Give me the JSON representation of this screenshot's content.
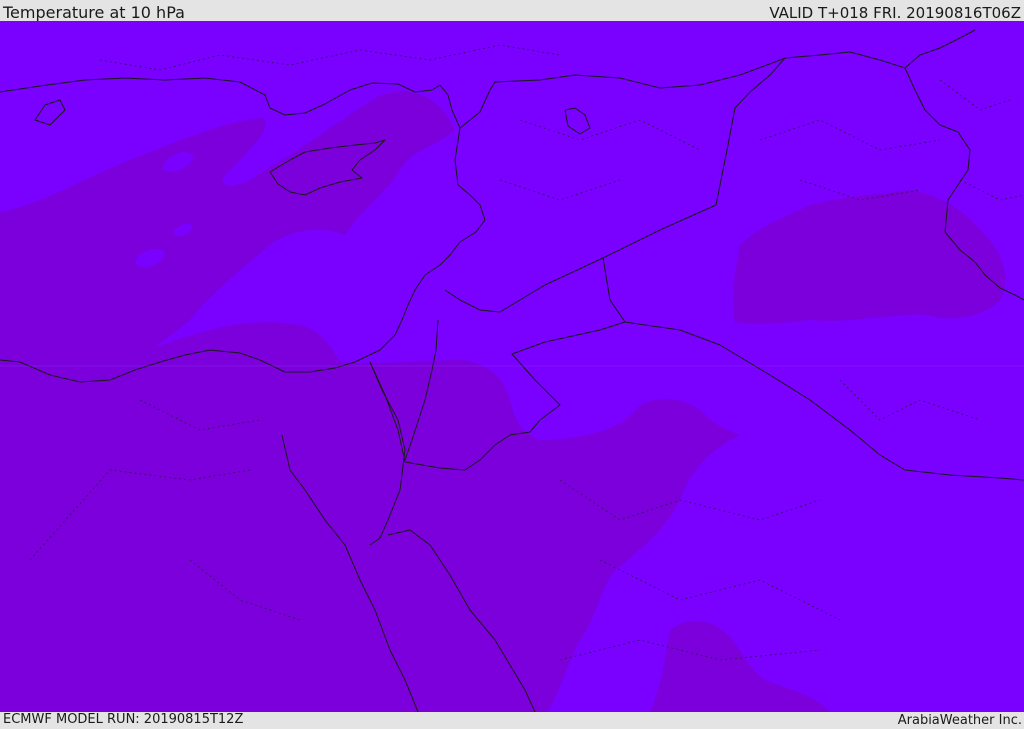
{
  "header": {
    "title": "Temperature at 10 hPa",
    "valid_time": "VALID T+018 FRI. 20190816T06Z"
  },
  "footer": {
    "model_run": "ECMWF MODEL RUN: 20190815T12Z",
    "credit": "ArabiaWeather Inc."
  },
  "map": {
    "region": "Eastern Mediterranean / Middle East",
    "colors": {
      "warmer_band": "#7a00ff",
      "cooler_band": "#7c00dc",
      "borders": "#1a1a1a"
    }
  }
}
